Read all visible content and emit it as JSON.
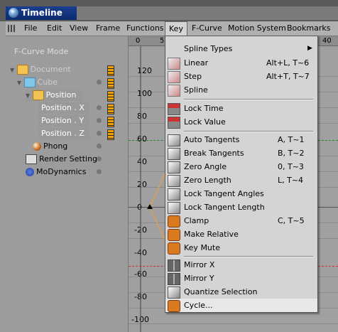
{
  "window": {
    "title": "Timeline"
  },
  "menubar": {
    "items": [
      {
        "label": "File"
      },
      {
        "label": "Edit"
      },
      {
        "label": "View"
      },
      {
        "label": "Frame"
      },
      {
        "label": "Functions"
      },
      {
        "label": "Key"
      },
      {
        "label": "F-Curve"
      },
      {
        "label": "Motion System"
      },
      {
        "label": "Bookmarks"
      }
    ],
    "active": "Key"
  },
  "left_panel": {
    "mode_label": "F-Curve Mode",
    "tree": [
      {
        "label": "Document",
        "icon": "folder-icon"
      },
      {
        "label": "Cube",
        "icon": "cube-icon"
      },
      {
        "label": "Position",
        "icon": "folder-icon"
      },
      {
        "label": "Position . X"
      },
      {
        "label": "Position . Y"
      },
      {
        "label": "Position . Z"
      },
      {
        "label": "Phong",
        "icon": "phong-tag-icon"
      },
      {
        "label": "Render Setting",
        "icon": "render-setting-icon"
      },
      {
        "label": "MoDynamics",
        "icon": "modynamics-icon"
      }
    ]
  },
  "graph": {
    "ruler_ticks": [
      "0",
      "5",
      "40"
    ],
    "y_labels": [
      "120",
      "100",
      "80",
      "60",
      "40",
      "20",
      "0",
      "-20",
      "-40",
      "-60",
      "-80",
      "-100"
    ]
  },
  "dropdown": {
    "items": [
      {
        "label": "Spline Types",
        "shortcut": "",
        "submenu": true,
        "icon": ""
      },
      {
        "label": "Linear",
        "shortcut": "Alt+L, T~6",
        "icon": "linear-icon"
      },
      {
        "label": "Step",
        "shortcut": "Alt+T, T~7",
        "icon": "step-icon"
      },
      {
        "label": "Spline",
        "shortcut": "",
        "icon": "spline-icon"
      },
      {
        "label": "Lock Time",
        "shortcut": "",
        "icon": "lock-time-icon"
      },
      {
        "label": "Lock Value",
        "shortcut": "",
        "icon": "lock-value-icon"
      },
      {
        "label": "Auto Tangents",
        "shortcut": "A, T~1",
        "icon": "auto-tangents-icon"
      },
      {
        "label": "Break Tangents",
        "shortcut": "B, T~2",
        "icon": "break-tangents-icon"
      },
      {
        "label": "Zero Angle",
        "shortcut": "0, T~3",
        "icon": "zero-angle-icon"
      },
      {
        "label": "Zero Length",
        "shortcut": "L, T~4",
        "icon": "zero-length-icon"
      },
      {
        "label": "Lock Tangent Angles",
        "shortcut": "",
        "icon": "lock-tangent-angles-icon"
      },
      {
        "label": "Lock Tangent Length",
        "shortcut": "",
        "icon": "lock-tangent-length-icon"
      },
      {
        "label": "Clamp",
        "shortcut": "C, T~5",
        "icon": "clamp-icon"
      },
      {
        "label": "Make Relative",
        "shortcut": "",
        "icon": "make-relative-icon"
      },
      {
        "label": "Key Mute",
        "shortcut": "",
        "icon": "key-mute-icon"
      },
      {
        "label": "Mirror X",
        "shortcut": "",
        "icon": "mirror-x-icon"
      },
      {
        "label": "Mirror Y",
        "shortcut": "",
        "icon": "mirror-y-icon"
      },
      {
        "label": "Quantize Selection",
        "shortcut": "",
        "icon": "quantize-selection-icon"
      },
      {
        "label": "Cycle...",
        "shortcut": "",
        "icon": "cycle-icon"
      }
    ],
    "hovered": "Cycle..."
  },
  "colors": {
    "title_bar": "#0b2a6e",
    "curve": "#d9a050",
    "menu_bg": "#d4d4d4"
  }
}
